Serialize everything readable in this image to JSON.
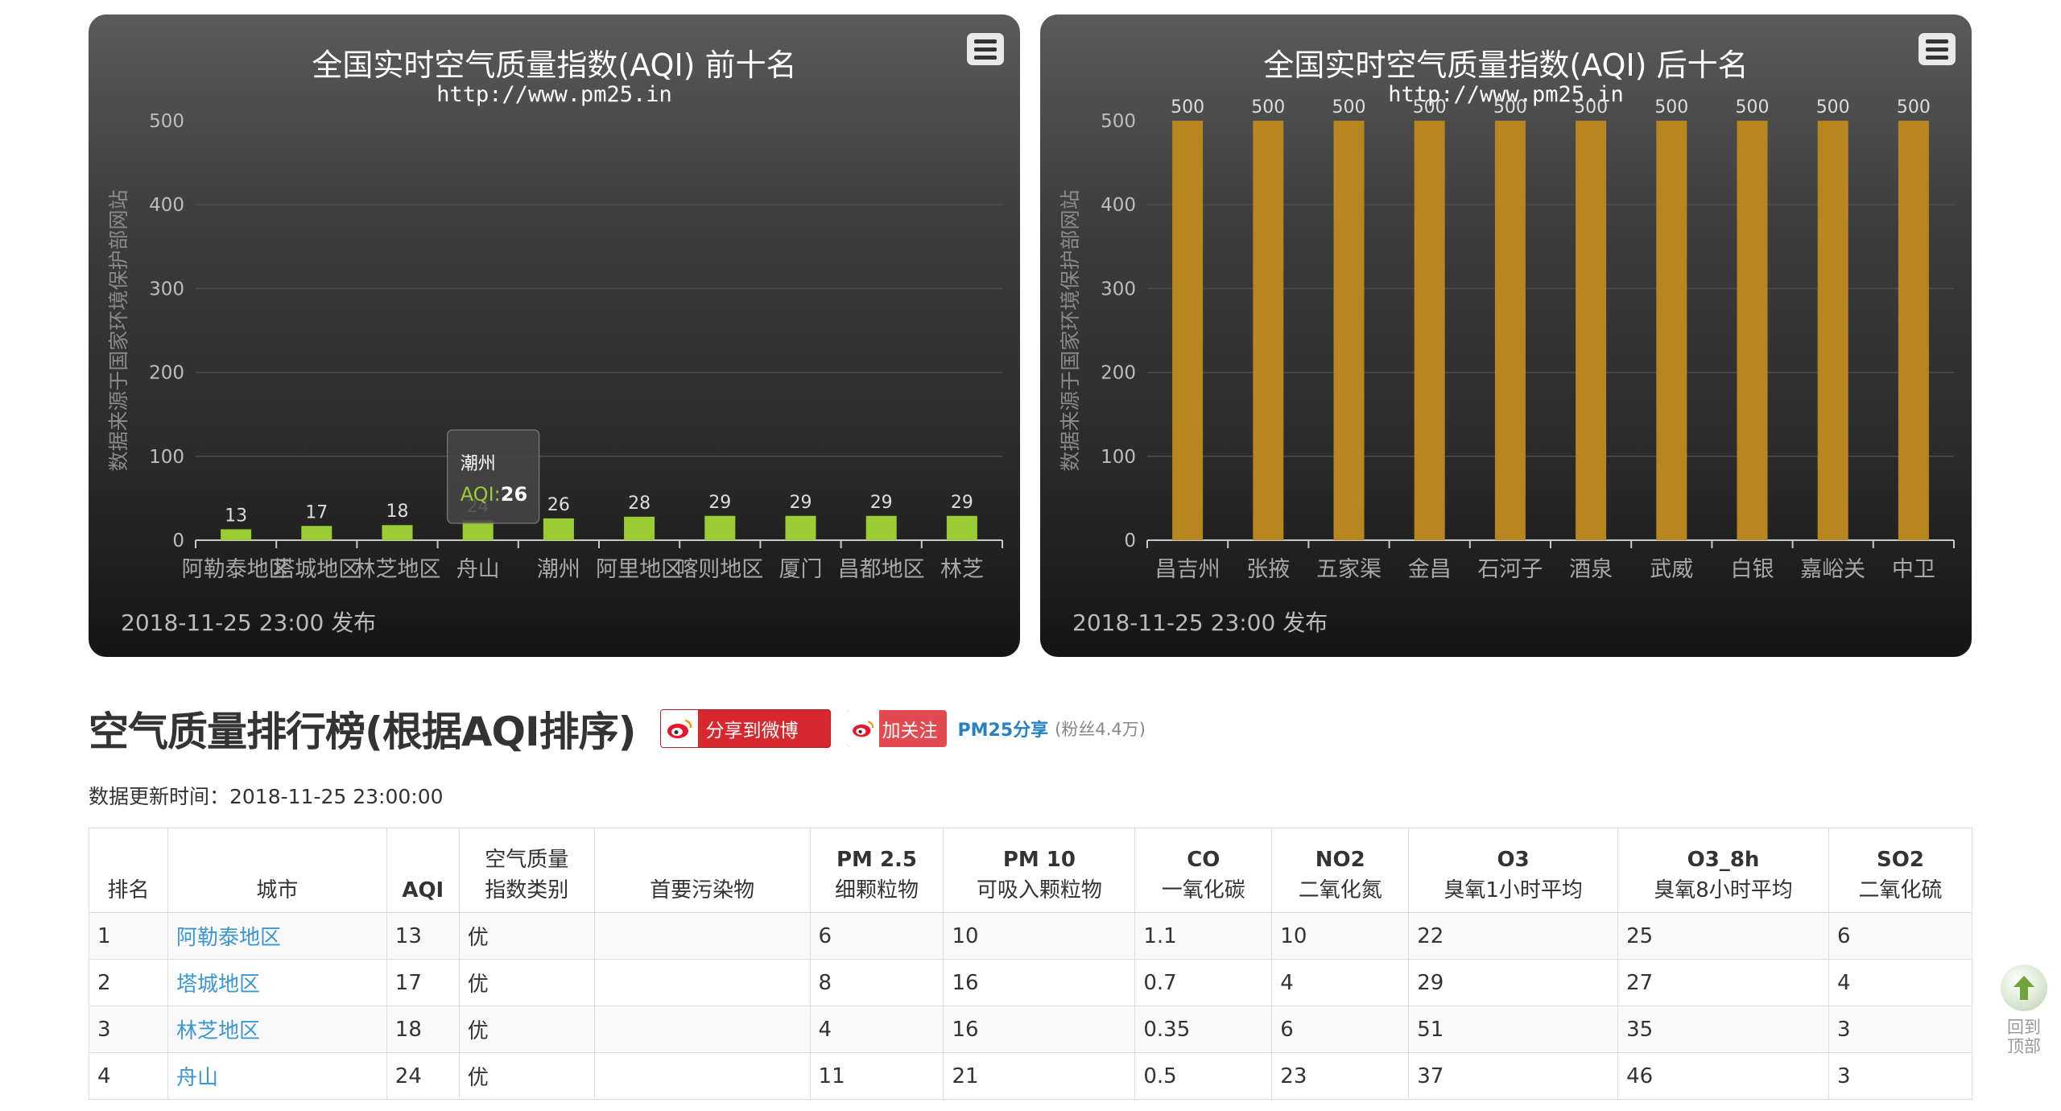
{
  "chart_data": [
    {
      "type": "bar",
      "title": "全国实时空气质量指数(AQI) 前十名",
      "subtitle": "http://www.pm25.in",
      "ylabel": "数据来源于国家环境保护部网站",
      "categories": [
        "阿勒泰地区",
        "塔城地区",
        "林芝地区",
        "舟山",
        "潮州",
        "阿里地区",
        "喀则地区",
        "厦门",
        "昌都地区",
        "林芝"
      ],
      "values": [
        13,
        17,
        18,
        24,
        26,
        28,
        29,
        29,
        29,
        29
      ],
      "data_labels": [
        "13",
        "17",
        "18",
        "24",
        "26",
        "28",
        "29",
        "29",
        "29",
        "29"
      ],
      "ylim": [
        0,
        500
      ],
      "yticks": [
        0,
        100,
        200,
        300,
        400,
        500
      ],
      "bar_color": "#9ccc33",
      "grid": true,
      "credit": "2018-11-25 23:00 发布",
      "tooltip": {
        "city": "潮州",
        "label": "AQI:",
        "value": "26",
        "index": 4
      }
    },
    {
      "type": "bar",
      "title": "全国实时空气质量指数(AQI) 后十名",
      "subtitle": "http://www.pm25.in",
      "ylabel": "数据来源于国家环境保护部网站",
      "categories": [
        "昌吉州",
        "张掖",
        "五家渠",
        "金昌",
        "石河子",
        "酒泉",
        "武威",
        "白银",
        "嘉峪关",
        "中卫"
      ],
      "values": [
        500,
        500,
        500,
        500,
        500,
        500,
        500,
        500,
        500,
        500
      ],
      "data_labels": [
        "500",
        "500",
        "500",
        "500",
        "500",
        "500",
        "500",
        "500",
        "500",
        "500"
      ],
      "ylim": [
        0,
        500
      ],
      "yticks": [
        0,
        100,
        200,
        300,
        400,
        500
      ],
      "bar_color": "#b8861e",
      "grid": true,
      "credit": "2018-11-25 23:00 发布"
    }
  ],
  "heading": {
    "title": "空气质量排行榜(根据AQI排序)",
    "share_weibo": "分享到微博",
    "follow": "加关注",
    "account": "PM25分享",
    "fans": "(粉丝4.4万)"
  },
  "update_time": "数据更新时间：2018-11-25 23:00:00",
  "table": {
    "headers": [
      {
        "l1": "排名",
        "l2": ""
      },
      {
        "l1": "城市",
        "l2": ""
      },
      {
        "l1": "AQI",
        "l2": ""
      },
      {
        "l1": "空气质量",
        "l2": "指数类别"
      },
      {
        "l1": "首要污染物",
        "l2": ""
      },
      {
        "l1": "PM 2.5",
        "l2": "细颗粒物"
      },
      {
        "l1": "PM 10",
        "l2": "可吸入颗粒物"
      },
      {
        "l1": "CO",
        "l2": "一氧化碳"
      },
      {
        "l1": "NO2",
        "l2": "二氧化氮"
      },
      {
        "l1": "O3",
        "l2": "臭氧1小时平均"
      },
      {
        "l1": "O3_8h",
        "l2": "臭氧8小时平均"
      },
      {
        "l1": "SO2",
        "l2": "二氧化硫"
      }
    ],
    "rows": [
      [
        "1",
        "阿勒泰地区",
        "13",
        "优",
        "",
        "6",
        "10",
        "1.1",
        "10",
        "22",
        "25",
        "6"
      ],
      [
        "2",
        "塔城地区",
        "17",
        "优",
        "",
        "8",
        "16",
        "0.7",
        "4",
        "29",
        "27",
        "4"
      ],
      [
        "3",
        "林芝地区",
        "18",
        "优",
        "",
        "4",
        "16",
        "0.35",
        "6",
        "51",
        "35",
        "3"
      ],
      [
        "4",
        "舟山",
        "24",
        "优",
        "",
        "11",
        "21",
        "0.5",
        "23",
        "37",
        "46",
        "3"
      ]
    ]
  },
  "back_top": {
    "line1": "回到",
    "line2": "顶部"
  },
  "icons": {
    "chart_menu": "menu-icon",
    "weibo": "weibo-icon",
    "back_top": "arrow-up-icon"
  }
}
